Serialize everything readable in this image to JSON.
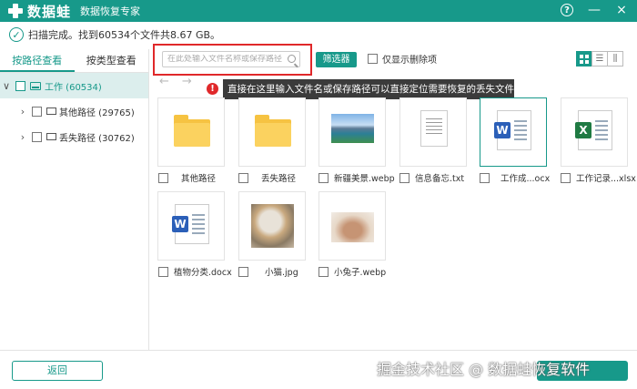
{
  "titlebar": {
    "app_name": "数据蛙",
    "subtitle": "数据恢复专家"
  },
  "window_buttons": {
    "help": "?",
    "minimize": "—",
    "close": "×"
  },
  "status": {
    "text": "扫描完成。找到60534个文件共8.67 GB。"
  },
  "left_tabs": [
    {
      "label": "按路径查看",
      "active": true
    },
    {
      "label": "按类型查看",
      "active": false
    }
  ],
  "tree": [
    {
      "label": "工作 (60534)",
      "expanded": true,
      "selected": true
    },
    {
      "label": "其他路径 (29765)",
      "expanded": false,
      "selected": false
    },
    {
      "label": "丢失路径 (30762)",
      "expanded": false,
      "selected": false
    }
  ],
  "toolbar": {
    "search_placeholder": "在此处输入文件名称或保存路径",
    "filter_label": "筛选器",
    "only_deleted_label": "仅显示删除项"
  },
  "nav": {
    "back": "←",
    "forward": "→"
  },
  "tooltip": {
    "badge": "!",
    "text": "直接在这里输入文件名或保存路径可以直接定位需要恢复的丢失文件"
  },
  "files": [
    {
      "name": "其他路径",
      "icon": "folder-icon"
    },
    {
      "name": "丢失路径",
      "icon": "folder-icon"
    },
    {
      "name": "新疆美景.webp",
      "icon": "landscape-image-icon"
    },
    {
      "name": "信息备忘.txt",
      "icon": "text-document-icon"
    },
    {
      "name": "工作成...ocx",
      "icon": "word-document-icon",
      "selected": true
    },
    {
      "name": "工作记录...xlsx",
      "icon": "excel-document-icon"
    },
    {
      "name": "植物分类.docx",
      "icon": "word-document-icon"
    },
    {
      "name": "小猫.jpg",
      "icon": "cat-photo-icon"
    },
    {
      "name": "小兔子.webp",
      "icon": "rabbit-photo-icon"
    }
  ],
  "office_badges": {
    "word": "W",
    "excel": "X"
  },
  "bottom": {
    "back_label": "返回",
    "watermark": "掘金技术社区 @ 数据蛙恢复软件"
  },
  "colors": {
    "accent": "#17998a",
    "highlight": "#e0282a"
  }
}
